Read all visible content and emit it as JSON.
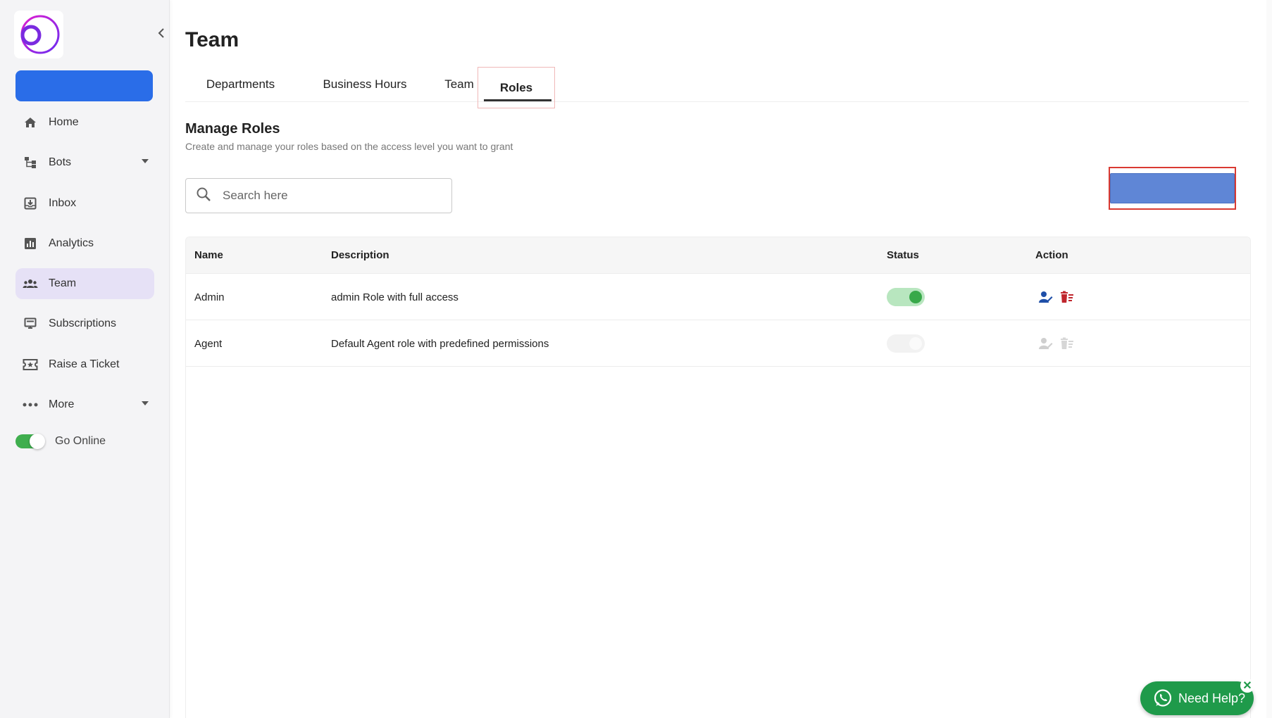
{
  "sidebar": {
    "items": [
      {
        "label": "Home",
        "icon": "home-icon"
      },
      {
        "label": "Bots",
        "icon": "bots-icon"
      },
      {
        "label": "Inbox",
        "icon": "inbox-icon"
      },
      {
        "label": "Analytics",
        "icon": "analytics-icon"
      },
      {
        "label": "Team",
        "icon": "team-icon"
      },
      {
        "label": "Subscriptions",
        "icon": "subscriptions-icon"
      },
      {
        "label": "Raise a Ticket",
        "icon": "ticket-icon"
      },
      {
        "label": "More",
        "icon": "more-icon"
      }
    ],
    "go_online_label": "Go Online"
  },
  "header": {
    "title": "Team"
  },
  "tabs": [
    {
      "label": "Departments"
    },
    {
      "label": "Business Hours"
    },
    {
      "label": "Team"
    },
    {
      "label": "Roles"
    }
  ],
  "section": {
    "title": "Manage Roles",
    "subtitle": "Create and manage your roles based on the access level you want to grant"
  },
  "search": {
    "placeholder": "Search here",
    "value": ""
  },
  "table": {
    "headers": {
      "name": "Name",
      "description": "Description",
      "status": "Status",
      "action": "Action"
    },
    "rows": [
      {
        "name": "Admin",
        "description": "admin Role with full access",
        "status_on": true
      },
      {
        "name": "Agent",
        "description": "Default Agent role with predefined permissions",
        "status_on": false
      }
    ]
  },
  "help": {
    "label": "Need Help?",
    "close": "✕"
  },
  "colors": {
    "accent": "#2a6de8",
    "active_nav": "#e6e1f6",
    "toggle_on": "#38a949",
    "help_green": "#1f9a4a",
    "delete_red": "#c0262d",
    "edit_blue": "#1f4fa8"
  }
}
